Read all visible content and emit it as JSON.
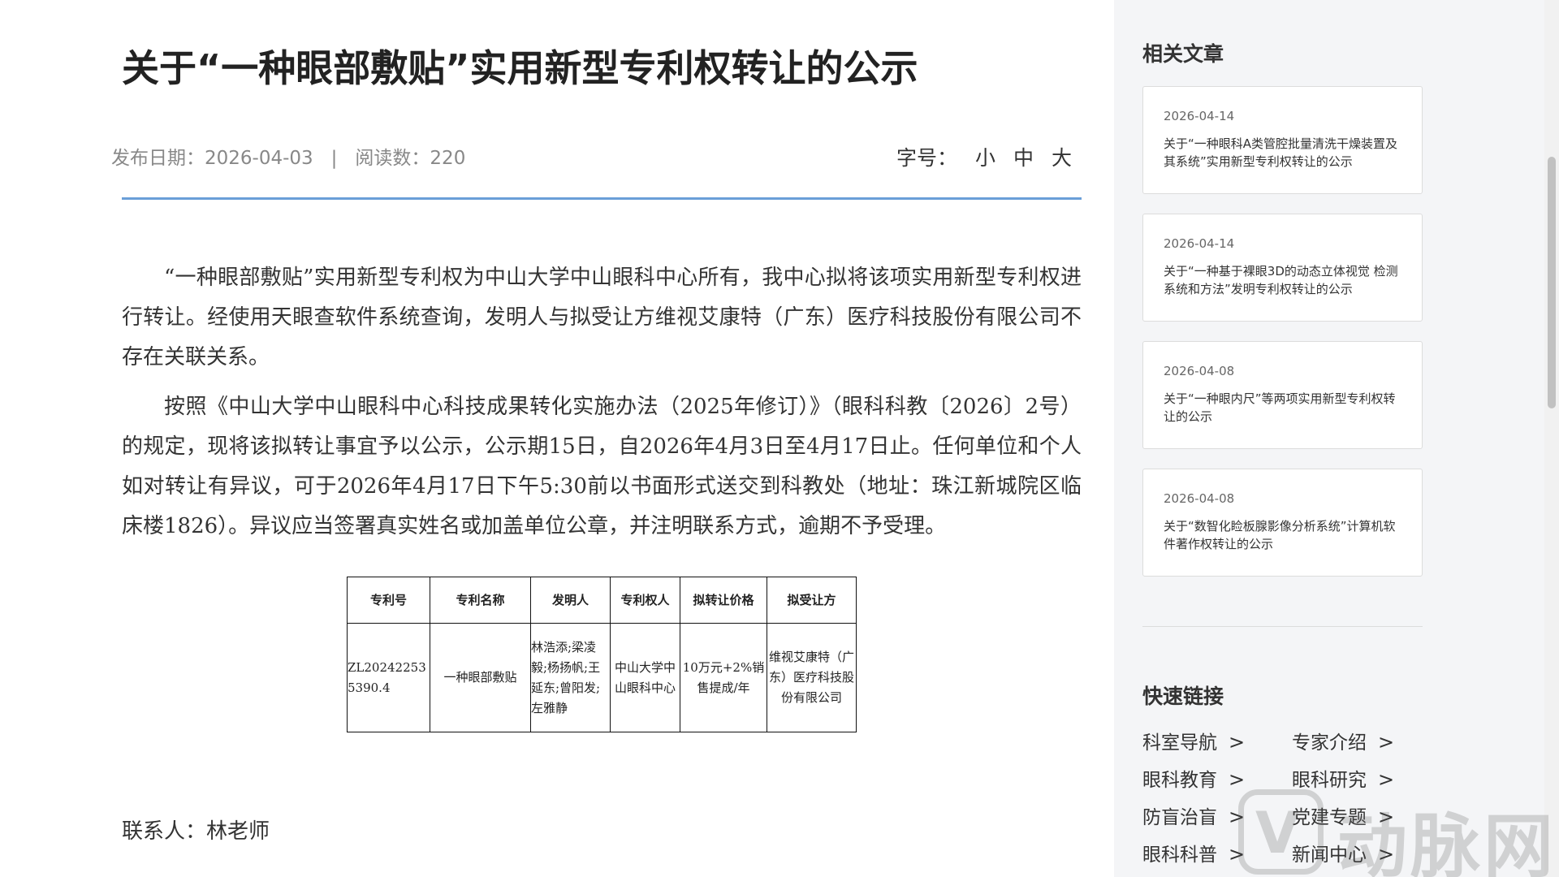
{
  "article": {
    "title": "关于“一种眼部敷贴”实用新型专利权转让的公示",
    "publish_label": "发布日期：",
    "publish_date": "2026-04-03",
    "separator": "|",
    "views_label": "阅读数：",
    "views": "220",
    "fontsize_label": "字号：",
    "fontsize_small": "小",
    "fontsize_medium": "中",
    "fontsize_large": "大",
    "paragraphs": [
      "“一种眼部敷贴”实用新型专利权为中山大学中山眼科中心所有，我中心拟将该项实用新型专利权进行转让。经使用天眼查软件系统查询，发明人与拟受让方维视艾康特（广东）医疗科技股份有限公司不存在关联关系。",
      "按照《中山大学中山眼科中心科技成果转化实施办法（2025年修订）》（眼科科教〔2026〕2号）的规定，现将该拟转让事宜予以公示，公示期15日，自2026年4月3日至4月17日止。任何单位和个人如对转让有异议，可于2026年4月17日下午5:30前以书面形式送交到科教处（地址：珠江新城院区临床楼1826）。异议应当签署真实姓名或加盖单位公章，并注明联系方式，逾期不予受理。"
    ],
    "table": {
      "headers": [
        "专利号",
        "专利名称",
        "发明人",
        "专利权人",
        "拟转让价格",
        "拟受让方"
      ],
      "row": [
        "ZL202422535390.4",
        "一种眼部敷贴",
        "林浩添;梁凌毅;杨扬帆;王延东;曾阳发;左雅静",
        "中山大学中山眼科中心",
        "10万元+2%销售提成/年",
        "维视艾康特（广东）医疗科技股份有限公司"
      ]
    },
    "contact": "联系人：林老师"
  },
  "sidebar": {
    "related_heading": "相关文章",
    "related": [
      {
        "date": "2026-04-14",
        "title": "关于“一种眼科A类管腔批量清洗干燥装置及其系统”实用新型专利权转让的公示"
      },
      {
        "date": "2026-04-14",
        "title": "关于“一种基于裸眼3D的动态立体视觉 检测系统和方法”发明专利权转让的公示"
      },
      {
        "date": "2026-04-08",
        "title": "关于“一种眼内尺”等两项实用新型专利权转让的公示"
      },
      {
        "date": "2026-04-08",
        "title": "关于“数智化睑板腺影像分析系统”计算机软件著作权转让的公示"
      }
    ],
    "quick_heading": "快速链接",
    "links": [
      "科室导航",
      "专家介绍",
      "眼科教育",
      "眼科研究",
      "防盲治盲",
      "党建专题",
      "眼科科普",
      "新闻中心"
    ]
  },
  "watermark": {
    "text": "动脉网"
  }
}
